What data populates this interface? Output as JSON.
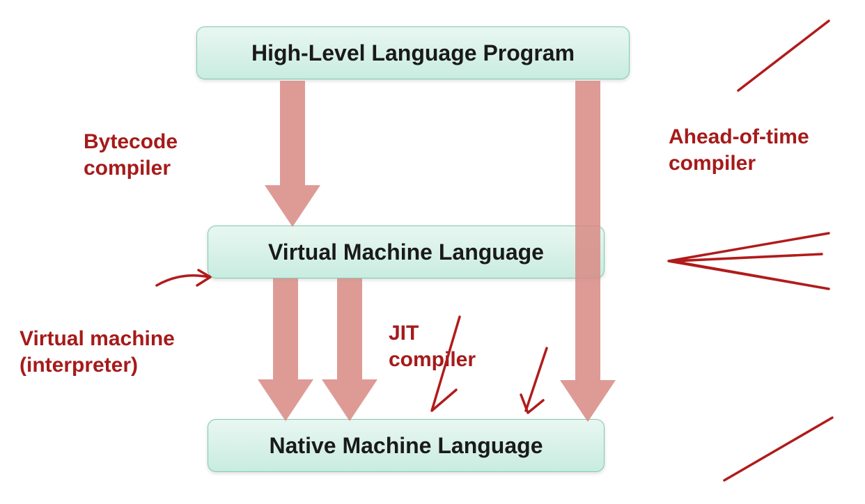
{
  "nodes": {
    "top": "High-Level Language Program",
    "middle": "Virtual Machine Language",
    "bottom": "Native Machine Language"
  },
  "labels": {
    "bytecode": "Bytecode\ncompiler",
    "aot": "Ahead-of-time\ncompiler",
    "interpreter": "Virtual machine\n(interpreter)",
    "jit": "JIT\ncompiler"
  },
  "colors": {
    "node_border": "#7fcab0",
    "node_bg_top": "#e8f7f1",
    "node_bg_bottom": "#c9ece0",
    "arrow_fill": "#d88a84",
    "label_text": "#a61a1a",
    "scribble": "#b11b1b"
  },
  "diagram": {
    "type": "flowchart",
    "edges": [
      {
        "from": "top",
        "to": "middle",
        "label_ref": "bytecode"
      },
      {
        "from": "top",
        "to": "bottom",
        "label_ref": "aot"
      },
      {
        "from": "middle",
        "to": "bottom",
        "label_ref": "interpreter"
      },
      {
        "from": "middle",
        "to": "bottom",
        "label_ref": "jit"
      }
    ]
  }
}
